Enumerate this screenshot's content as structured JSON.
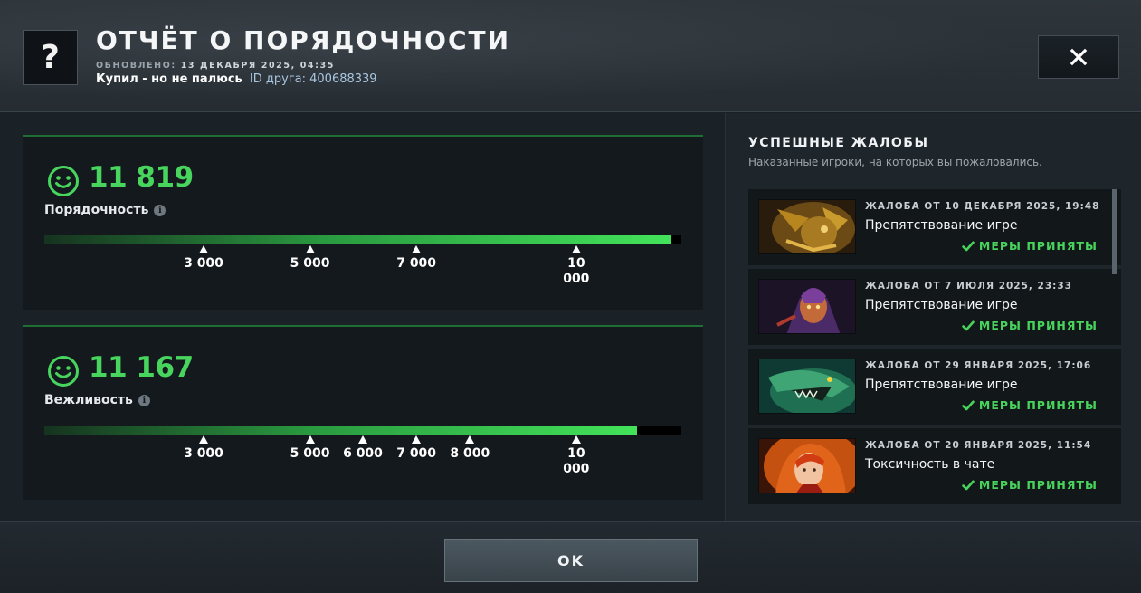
{
  "header": {
    "icon": "question-mark-icon",
    "icon_glyph": "?",
    "title": "ОТЧЁТ О ПОРЯДОЧНОСТИ",
    "updated_label": "ОБНОВЛЕНО:",
    "updated_value": "13 ДЕКАБРЯ 2025, 04:35",
    "player_name": "Купил - но не палюсь",
    "friend_id_label": "ID друга:",
    "friend_id": "400688339",
    "close_icon": "close-icon"
  },
  "behavior": {
    "value": "11 819",
    "label": "Порядочность",
    "fill_fraction": 0.985,
    "ticks": [
      {
        "label": "3 000",
        "pos": 0.25
      },
      {
        "label": "5 000",
        "pos": 0.417
      },
      {
        "label": "7 000",
        "pos": 0.584
      },
      {
        "label": "10\n000",
        "pos": 0.835
      }
    ]
  },
  "communication": {
    "value": "11 167",
    "label": "Вежливость",
    "fill_fraction": 0.93,
    "ticks": [
      {
        "label": "3 000",
        "pos": 0.25
      },
      {
        "label": "5 000",
        "pos": 0.417
      },
      {
        "label": "6 000",
        "pos": 0.5
      },
      {
        "label": "7 000",
        "pos": 0.584
      },
      {
        "label": "8 000",
        "pos": 0.668
      },
      {
        "label": "10\n000",
        "pos": 0.835
      }
    ]
  },
  "reports": {
    "title": "УСПЕШНЫЕ ЖАЛОБЫ",
    "subtitle": "Наказанные игроки, на которых вы пожаловались.",
    "items": [
      {
        "date": "ЖАЛОБА ОТ 10 ДЕКАБРЯ 2025, 19:48",
        "reason": "Препятствование игре",
        "status": "МЕРЫ ПРИНЯТЫ",
        "hero": "sand-king"
      },
      {
        "date": "ЖАЛОБА ОТ 7 ИЮЛЯ 2025, 23:33",
        "reason": "Препятствование игре",
        "status": "МЕРЫ ПРИНЯТЫ",
        "hero": "anti-mage"
      },
      {
        "date": "ЖАЛОБА ОТ 29 ЯНВАРЯ 2025, 17:06",
        "reason": "Препятствование игре",
        "status": "МЕРЫ ПРИНЯТЫ",
        "hero": "slark"
      },
      {
        "date": "ЖАЛОБА ОТ 20 ЯНВАРЯ 2025, 11:54",
        "reason": "Токсичность в чате",
        "status": "МЕРЫ ПРИНЯТЫ",
        "hero": "lina"
      }
    ]
  },
  "footer": {
    "ok_label": "OK"
  },
  "colors": {
    "accent_green": "#47d55e",
    "status_green": "#48d45c",
    "background": "#1b2227"
  }
}
